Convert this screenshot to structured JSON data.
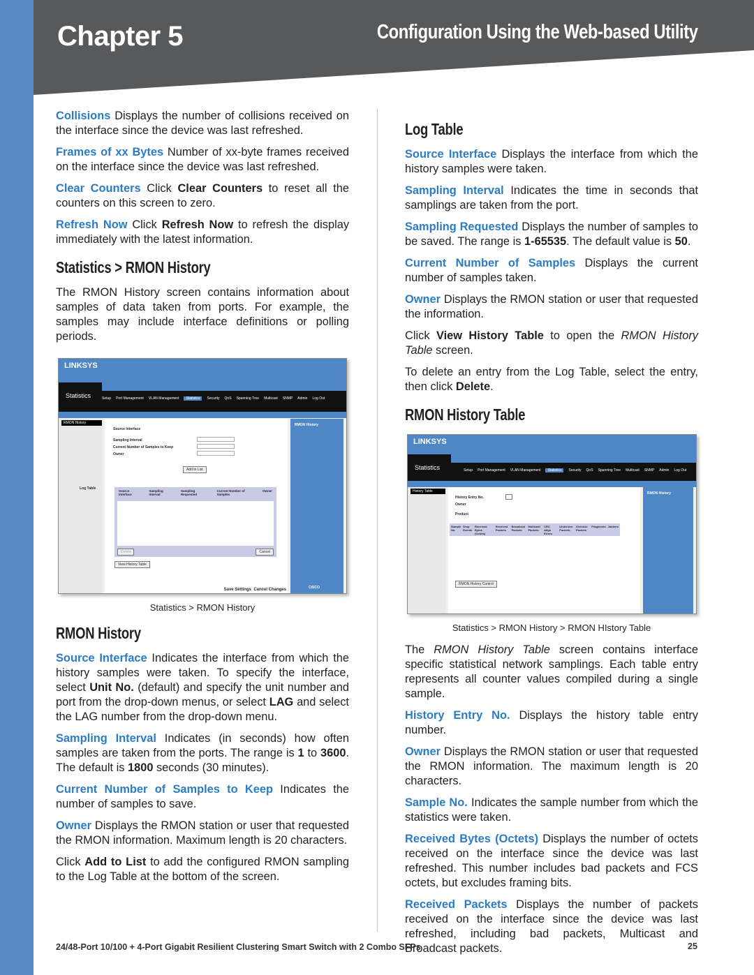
{
  "header": {
    "chapter": "Chapter 5",
    "title": "Configuration Using the Web-based Utility"
  },
  "colors": {
    "sidebar": "#5b8ac9",
    "header": "#58595b",
    "term": "#2b7cc4"
  },
  "left": {
    "a": [
      {
        "type": "p",
        "segs": [
          {
            "s": "term",
            "t": "Collisions"
          },
          {
            "t": "  Displays the number of collisions received on the interface since the device was last refreshed."
          }
        ]
      },
      {
        "type": "p",
        "segs": [
          {
            "s": "term",
            "t": "Frames of xx Bytes"
          },
          {
            "t": "  Number of xx-byte frames received on the interface since the device was last refreshed."
          }
        ]
      },
      {
        "type": "p",
        "segs": [
          {
            "s": "term",
            "t": "Clear Counters"
          },
          {
            "t": "  Click "
          },
          {
            "s": "b",
            "t": "Clear Counters"
          },
          {
            "t": " to reset all the counters on this screen to zero."
          }
        ]
      },
      {
        "type": "p",
        "segs": [
          {
            "s": "term",
            "t": "Refresh Now"
          },
          {
            "t": "  Click "
          },
          {
            "s": "b",
            "t": "Refresh Now"
          },
          {
            "t": " to refresh the display immediately with the latest information."
          }
        ]
      },
      {
        "type": "h",
        "text": "Statistics > RMON History"
      },
      {
        "type": "p",
        "segs": [
          {
            "t": "The RMON History screen contains information about samples of data taken from ports. For example, the samples may include interface definitions or polling periods."
          }
        ]
      }
    ],
    "figure": {
      "caption": "Statistics > RMON History",
      "brand": "LINKSYS",
      "section": "Statistics",
      "nav": [
        "Setup",
        "Port Management",
        "VLAN Management",
        "Statistics",
        "Security",
        "QoS",
        "Spanning Tree",
        "Multicast",
        "SNMP",
        "Admin",
        "Log Out"
      ],
      "menu_item": "RMON History",
      "log_table": "Log Table",
      "fields": [
        "Source Interface",
        "Sampling Interval",
        "Current Number of Samples to Keep",
        "Owner"
      ],
      "columns": [
        "Source Interface",
        "Sampling Interval",
        "Sampling Requested",
        "Current Number of Samples",
        "Owner"
      ],
      "add_button": "Add to List",
      "delete_button": "Delete",
      "cancel_button": "Cancel",
      "view_button": "View History Table",
      "save": "Save Settings",
      "cancel_changes": "Cancel Changes",
      "help_title": "RMON History",
      "cisco": "CISCO"
    },
    "b": [
      {
        "type": "h",
        "text": "RMON History"
      },
      {
        "type": "p",
        "segs": [
          {
            "s": "term",
            "t": "Source Interface"
          },
          {
            "t": "  Indicates the interface from which the history samples were taken. To specify the interface, select "
          },
          {
            "s": "b",
            "t": "Unit No."
          },
          {
            "t": " (default) and specify the unit number and port from the drop-down menus, or select "
          },
          {
            "s": "b",
            "t": "LAG"
          },
          {
            "t": " and select the LAG number from the drop-down menu."
          }
        ]
      },
      {
        "type": "p",
        "segs": [
          {
            "s": "term",
            "t": "Sampling Interval"
          },
          {
            "t": "  Indicates (in seconds) how often samples are taken from the ports. The range is "
          },
          {
            "s": "b",
            "t": "1"
          },
          {
            "t": " to "
          },
          {
            "s": "b",
            "t": "3600"
          },
          {
            "t": ". The default is "
          },
          {
            "s": "b",
            "t": "1800"
          },
          {
            "t": " seconds (30 minutes)."
          }
        ]
      },
      {
        "type": "p",
        "segs": [
          {
            "s": "term",
            "t": "Current Number of Samples to Keep"
          },
          {
            "t": "  Indicates the number of samples to save."
          }
        ]
      },
      {
        "type": "p",
        "segs": [
          {
            "s": "term",
            "t": "Owner"
          },
          {
            "t": "  Displays the RMON station or user that requested the RMON information. Maximum length is 20 characters."
          }
        ]
      },
      {
        "type": "p",
        "segs": [
          {
            "t": "Click "
          },
          {
            "s": "b",
            "t": "Add to List"
          },
          {
            "t": " to add the configured RMON sampling to the Log Table at the bottom of the screen."
          }
        ]
      }
    ]
  },
  "right": {
    "a": [
      {
        "type": "h",
        "text": "Log Table"
      },
      {
        "type": "p",
        "segs": [
          {
            "s": "term",
            "t": "Source Interface"
          },
          {
            "t": "  Displays the interface from which the history samples were taken."
          }
        ]
      },
      {
        "type": "p",
        "segs": [
          {
            "s": "term",
            "t": "Sampling Interval"
          },
          {
            "t": "  Indicates the time in seconds that samplings are taken from the port."
          }
        ]
      },
      {
        "type": "p",
        "segs": [
          {
            "s": "term",
            "t": "Sampling Requested"
          },
          {
            "t": "  Displays the number of samples to be saved. The range is "
          },
          {
            "s": "b",
            "t": "1-65535"
          },
          {
            "t": ". The default value is "
          },
          {
            "s": "b",
            "t": "50"
          },
          {
            "t": "."
          }
        ]
      },
      {
        "type": "p",
        "segs": [
          {
            "s": "term",
            "t": "Current Number of Samples"
          },
          {
            "t": "  Displays the current number of samples taken."
          }
        ]
      },
      {
        "type": "p",
        "segs": [
          {
            "s": "term",
            "t": "Owner"
          },
          {
            "t": "  Displays the RMON station or user that requested the information."
          }
        ]
      },
      {
        "type": "p",
        "segs": [
          {
            "t": "Click "
          },
          {
            "s": "b",
            "t": "View History Table"
          },
          {
            "t": " to open the "
          },
          {
            "s": "i",
            "t": "RMON History Table"
          },
          {
            "t": " screen."
          }
        ]
      },
      {
        "type": "p",
        "segs": [
          {
            "t": "To delete an entry from the Log Table, select the entry, then click "
          },
          {
            "s": "b",
            "t": "Delete"
          },
          {
            "t": "."
          }
        ]
      },
      {
        "type": "h",
        "text": "RMON History Table"
      }
    ],
    "figure": {
      "caption": "Statistics > RMON History > RMON HIstory Table",
      "brand": "LINKSYS",
      "section": "Statistics",
      "nav": [
        "Setup",
        "Port Management",
        "VLAN Management",
        "Statistics",
        "Security",
        "QoS",
        "Spanning Tree",
        "Multicast",
        "SNMP",
        "Admin",
        "Log Out"
      ],
      "menu_item": "History Table",
      "fields": [
        "History Entry No.",
        "Owner",
        "Product"
      ],
      "columns": [
        "Sample No.",
        "Drop Events",
        "Received Bytes (Octets)",
        "Received Packets",
        "Broadcast Packets",
        "Multicast Packets",
        "CRC Align Errors",
        "Undersize Packets",
        "Oversize Packets",
        "Fragments",
        "Jabbers"
      ],
      "control_button": "RMON History Control",
      "help_title": "RMON History"
    },
    "b": [
      {
        "type": "p",
        "segs": [
          {
            "t": "The "
          },
          {
            "s": "i",
            "t": "RMON History Table"
          },
          {
            "t": " screen contains interface specific statistical network samplings. Each table entry represents all counter values compiled during a single sample."
          }
        ]
      },
      {
        "type": "p",
        "segs": [
          {
            "s": "term",
            "t": "History Entry No."
          },
          {
            "t": "  Displays the history table entry number."
          }
        ]
      },
      {
        "type": "p",
        "segs": [
          {
            "s": "term",
            "t": "Owner"
          },
          {
            "t": "  Displays the RMON station or user that requested the RMON information. The maximum length is 20 characters."
          }
        ]
      },
      {
        "type": "p",
        "segs": [
          {
            "s": "term",
            "t": "Sample No."
          },
          {
            "t": "  Indicates the sample number from which the statistics were taken."
          }
        ]
      },
      {
        "type": "p",
        "segs": [
          {
            "s": "term",
            "t": "Received Bytes (Octets)"
          },
          {
            "t": "  Displays the number of octets received on the interface since the device was last refreshed. This number includes bad packets and FCS octets, but excludes framing bits."
          }
        ]
      },
      {
        "type": "p",
        "segs": [
          {
            "s": "term",
            "t": "Received Packets"
          },
          {
            "t": "  Displays the number of packets received on the interface since the device was last refreshed, including bad packets, Multicast and Broadcast packets."
          }
        ]
      }
    ]
  },
  "footer": {
    "text": "24/48-Port 10/100 + 4-Port Gigabit Resilient Clustering Smart Switch with 2 Combo SFPs",
    "page": "25"
  }
}
